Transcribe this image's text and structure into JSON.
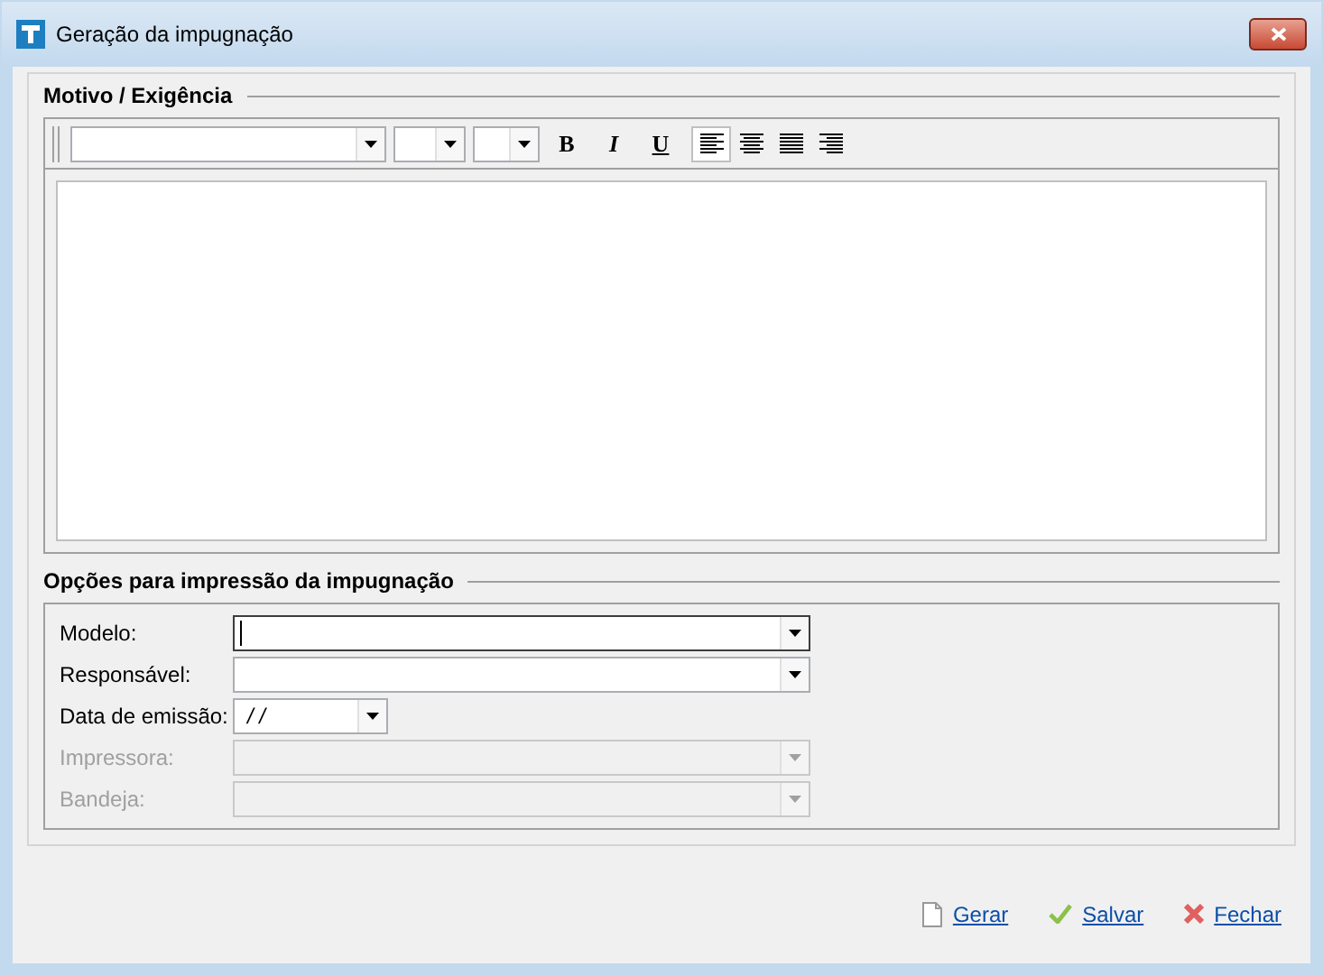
{
  "window": {
    "title": "Geração da impugnação"
  },
  "motivo": {
    "title": "Motivo / Exigência",
    "toolbar": {
      "format_buttons": [
        {
          "label": "B",
          "kind": "bold"
        },
        {
          "label": "I",
          "kind": "italic"
        },
        {
          "label": "U",
          "kind": "underline"
        }
      ],
      "align_buttons": [
        {
          "kind": "left",
          "selected": true
        },
        {
          "kind": "center",
          "selected": false
        },
        {
          "kind": "justify",
          "selected": false
        },
        {
          "kind": "right",
          "selected": false
        }
      ]
    }
  },
  "options": {
    "title": "Opções para impressão da impugnação",
    "fields": [
      {
        "label": "Modelo:",
        "kind": "wide",
        "disabled": false,
        "focused": true
      },
      {
        "label": "Responsável:",
        "kind": "wide",
        "disabled": false,
        "focused": false
      },
      {
        "label": "Data de emissão:",
        "kind": "date",
        "value": "/ /",
        "disabled": false,
        "focused": false
      },
      {
        "label": "Impressora:",
        "kind": "wide",
        "disabled": true,
        "focused": false
      },
      {
        "label": "Bandeja:",
        "kind": "wide",
        "disabled": true,
        "focused": false
      }
    ]
  },
  "buttons": [
    {
      "label": "Gerar",
      "kind": "document"
    },
    {
      "label": "Salvar",
      "kind": "check"
    },
    {
      "label": "Fechar",
      "kind": "close"
    }
  ]
}
